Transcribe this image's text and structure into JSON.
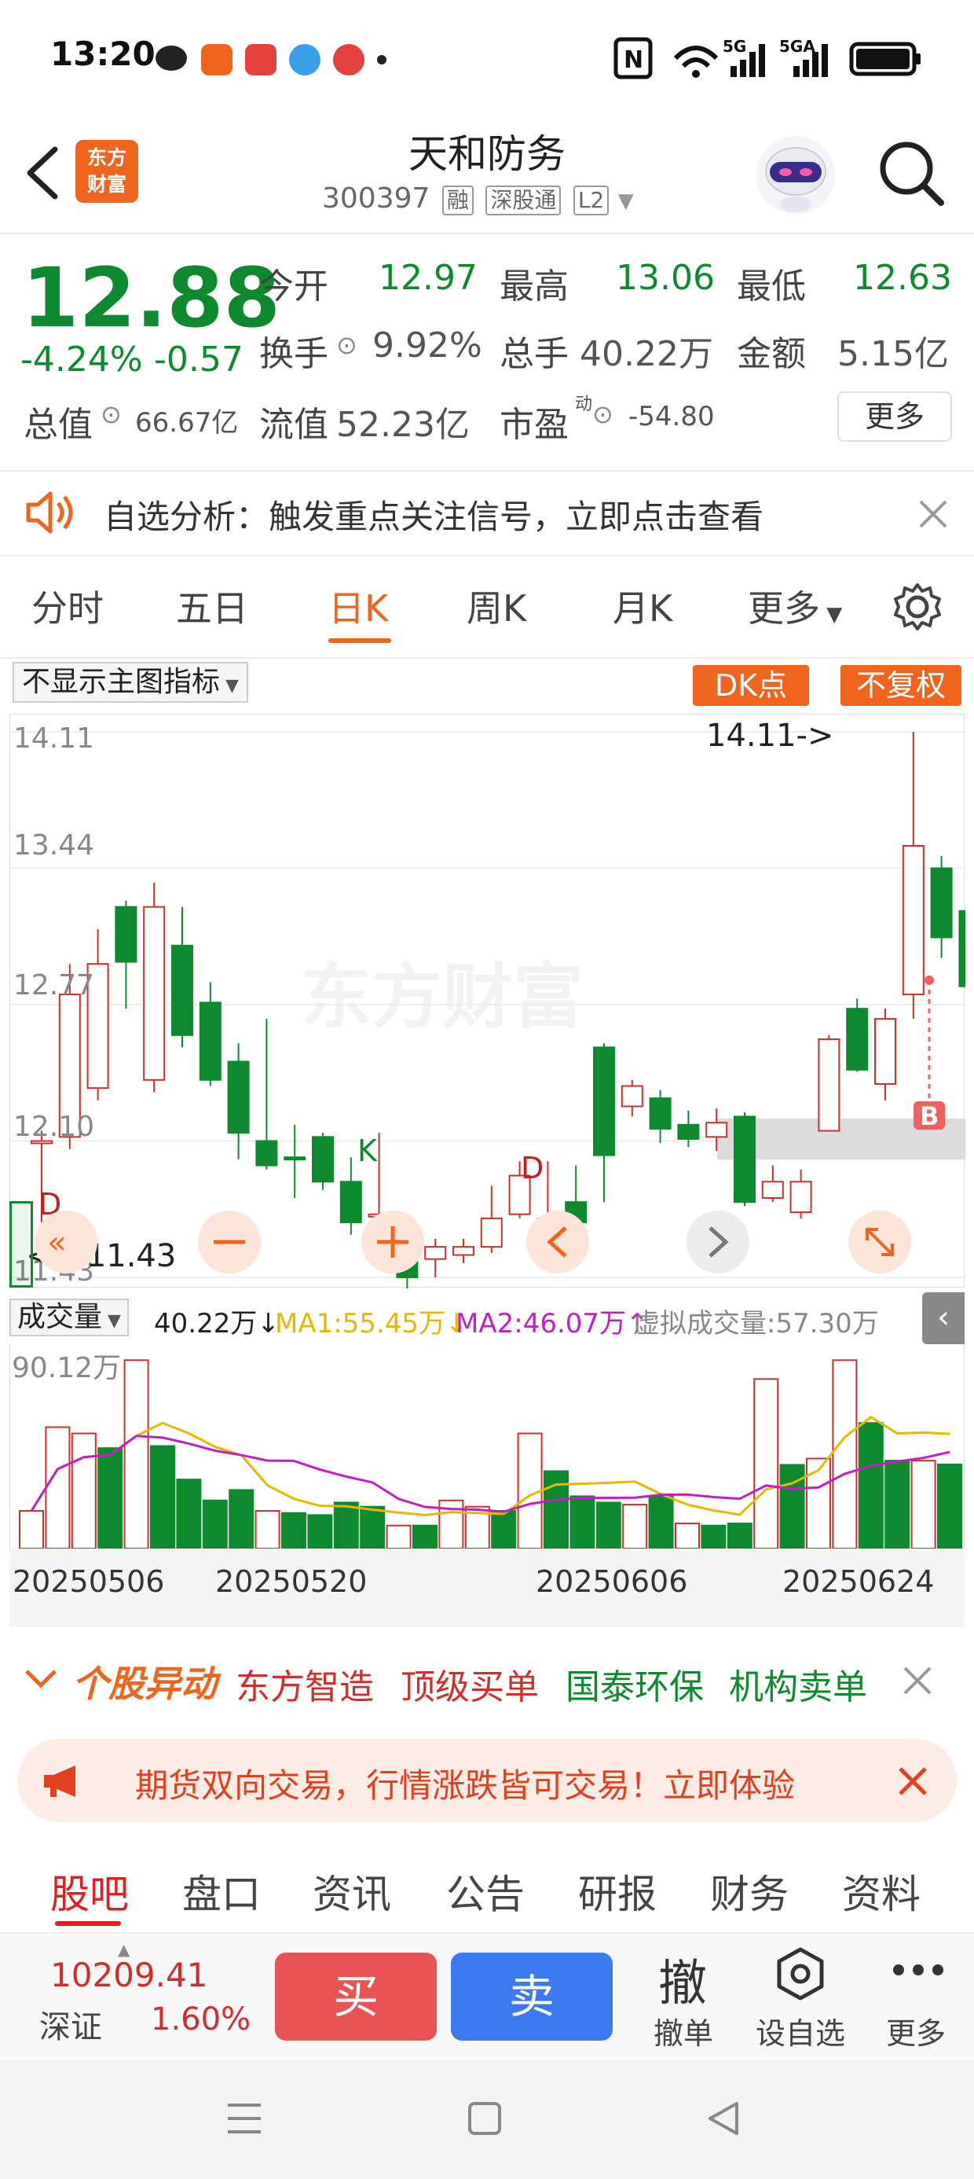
{
  "status": {
    "time": "13:20",
    "nfc": "N",
    "signal1": "5G",
    "signal2": "5GA"
  },
  "header": {
    "logo_line1": "东方",
    "logo_line2": "财富",
    "title": "天和防务",
    "code": "300397",
    "tags": [
      "融",
      "深股通",
      "L2"
    ]
  },
  "quote": {
    "price": "12.88",
    "change_pct": "-4.24%",
    "change": "-0.57",
    "open_label": "今开",
    "open": "12.97",
    "high_label": "最高",
    "high": "13.06",
    "low_label": "最低",
    "low": "12.63",
    "turnover_label": "换手",
    "turnover": "9.92%",
    "volume_label": "总手",
    "volume": "40.22万",
    "amount_label": "金额",
    "amount": "5.15亿",
    "mcap_label": "总值",
    "mcap": "66.67亿",
    "float_label": "流值",
    "float": "52.23亿",
    "pe_label": "市盈",
    "pe_sup": "动",
    "pe": "-54.80",
    "more": "更多"
  },
  "notice": {
    "text": "自选分析：触发重点关注信号，立即点击查看"
  },
  "tabs": [
    {
      "label": "分时",
      "active": false
    },
    {
      "label": "五日",
      "active": false
    },
    {
      "label": "日K",
      "active": true
    },
    {
      "label": "周K",
      "active": false
    },
    {
      "label": "月K",
      "active": false
    },
    {
      "label": "更多",
      "active": false
    }
  ],
  "chart_controls": {
    "indicator": "不显示主图指标",
    "dk_button": "DK点",
    "adjust_button": "不复权"
  },
  "chart_data": {
    "type": "candlestick",
    "y_ticks": [
      "14.11",
      "13.44",
      "12.77",
      "12.10",
      "11.43"
    ],
    "ylim": [
      11.43,
      14.11
    ],
    "high_annotation": "14.11->",
    "low_annotation": "<---11.43",
    "watermark": "东方财富",
    "markers": [
      "D",
      "K",
      "D",
      "B"
    ],
    "x_labels": [
      "20250506",
      "20250520",
      "20250606",
      "20250624"
    ],
    "candles": [
      {
        "o": 12.1,
        "c": 12.1,
        "h": 12.15,
        "l": 11.6
      },
      {
        "o": 12.12,
        "c": 12.82,
        "h": 12.97,
        "l": 12.06
      },
      {
        "o": 12.36,
        "c": 12.97,
        "h": 13.14,
        "l": 12.3
      },
      {
        "o": 13.25,
        "c": 12.98,
        "h": 13.28,
        "l": 12.75
      },
      {
        "o": 12.4,
        "c": 13.25,
        "h": 13.37,
        "l": 12.34
      },
      {
        "o": 13.06,
        "c": 12.62,
        "h": 13.25,
        "l": 12.56
      },
      {
        "o": 12.78,
        "c": 12.4,
        "h": 12.88,
        "l": 12.37
      },
      {
        "o": 12.49,
        "c": 12.14,
        "h": 12.58,
        "l": 12.01
      },
      {
        "o": 12.1,
        "c": 11.98,
        "h": 12.7,
        "l": 11.96
      },
      {
        "o": 12.02,
        "c": 12.01,
        "h": 12.18,
        "l": 11.82
      },
      {
        "o": 12.12,
        "c": 11.9,
        "h": 12.14,
        "l": 11.86
      },
      {
        "o": 11.9,
        "c": 11.7,
        "h": 12.02,
        "l": 11.64
      },
      {
        "o": 11.74,
        "c": 11.74,
        "h": 12.14,
        "l": 11.68
      },
      {
        "o": 11.69,
        "c": 11.43,
        "h": 11.69,
        "l": 11.37
      },
      {
        "o": 11.52,
        "c": 11.58,
        "h": 11.62,
        "l": 11.43
      },
      {
        "o": 11.54,
        "c": 11.58,
        "h": 11.62,
        "l": 11.5
      },
      {
        "o": 11.58,
        "c": 11.72,
        "h": 11.88,
        "l": 11.55
      },
      {
        "o": 11.74,
        "c": 11.93,
        "h": 12.0,
        "l": 11.72
      },
      {
        "o": 11.64,
        "c": 11.72,
        "h": 12.0,
        "l": 11.54
      },
      {
        "o": 11.8,
        "c": 11.7,
        "h": 11.98,
        "l": 11.6
      },
      {
        "o": 12.56,
        "c": 12.03,
        "h": 12.58,
        "l": 11.8
      },
      {
        "o": 12.27,
        "c": 12.37,
        "h": 12.4,
        "l": 12.22
      },
      {
        "o": 12.31,
        "c": 12.16,
        "h": 12.35,
        "l": 12.09
      },
      {
        "o": 12.18,
        "c": 12.11,
        "h": 12.25,
        "l": 12.07
      },
      {
        "o": 12.12,
        "c": 12.19,
        "h": 12.26,
        "l": 12.05
      },
      {
        "o": 12.22,
        "c": 11.8,
        "h": 12.24,
        "l": 11.78
      },
      {
        "o": 11.82,
        "c": 11.9,
        "h": 11.98,
        "l": 11.8
      },
      {
        "o": 11.75,
        "c": 11.9,
        "h": 11.96,
        "l": 11.72
      },
      {
        "o": 12.15,
        "c": 12.6,
        "h": 12.62,
        "l": 12.15
      },
      {
        "o": 12.75,
        "c": 12.45,
        "h": 12.8,
        "l": 12.44
      },
      {
        "o": 12.38,
        "c": 12.7,
        "h": 12.75,
        "l": 12.3
      },
      {
        "o": 12.82,
        "c": 13.55,
        "h": 14.11,
        "l": 12.7
      },
      {
        "o": 13.44,
        "c": 13.1,
        "h": 13.5,
        "l": 13.0
      },
      {
        "o": 13.23,
        "c": 12.86,
        "h": 13.27,
        "l": 12.8
      },
      {
        "o": 12.98,
        "c": 13.32,
        "h": 13.37,
        "l": 12.95
      },
      {
        "o": 12.97,
        "c": 12.88,
        "h": 13.06,
        "l": 12.63
      }
    ]
  },
  "volume": {
    "selector": "成交量",
    "total": "40.22万",
    "ma1": "MA1:55.45万",
    "ma2": "MA2:46.07万",
    "virtual": "虚拟成交量:57.30万",
    "max_label": "90.12万",
    "values": [
      18,
      58,
      55,
      48,
      90,
      49,
      33,
      23,
      28,
      18,
      17,
      16,
      22,
      20,
      11,
      11,
      23,
      20,
      18,
      55,
      37,
      25,
      22,
      21,
      25,
      12,
      11,
      12,
      81,
      40,
      43,
      90,
      60,
      42,
      42,
      40.22
    ],
    "colors": [
      "r",
      "r",
      "r",
      "g",
      "r",
      "g",
      "g",
      "g",
      "g",
      "r",
      "g",
      "g",
      "g",
      "g",
      "r",
      "g",
      "r",
      "r",
      "g",
      "r",
      "g",
      "g",
      "g",
      "r",
      "g",
      "r",
      "g",
      "g",
      "r",
      "g",
      "r",
      "r",
      "g",
      "g",
      "r",
      "g"
    ]
  },
  "alert": {
    "title": "个股异动",
    "items": [
      {
        "text": "东方智造",
        "color": "red"
      },
      {
        "text": "顶级买单",
        "color": "red"
      },
      {
        "text": "国泰环保",
        "color": "green"
      },
      {
        "text": "机构卖单",
        "color": "green"
      }
    ]
  },
  "ad": {
    "text": "期货双向交易，行情涨跌皆可交易！立即体验"
  },
  "bottom_tabs": [
    "股吧",
    "盘口",
    "资讯",
    "公告",
    "研报",
    "财务",
    "资料"
  ],
  "trade": {
    "index_value": "10209.41",
    "index_name": "深证",
    "index_change": "1.60%",
    "buy": "买",
    "sell": "卖",
    "cancel_icon": "撤",
    "cancel": "撤单",
    "watch": "设自选",
    "more": "更多"
  },
  "colors": {
    "up": "#d22d2d",
    "down": "#0e8a2e",
    "accent": "#f0641e",
    "buy": "#e95353",
    "sell": "#3c78f0"
  }
}
